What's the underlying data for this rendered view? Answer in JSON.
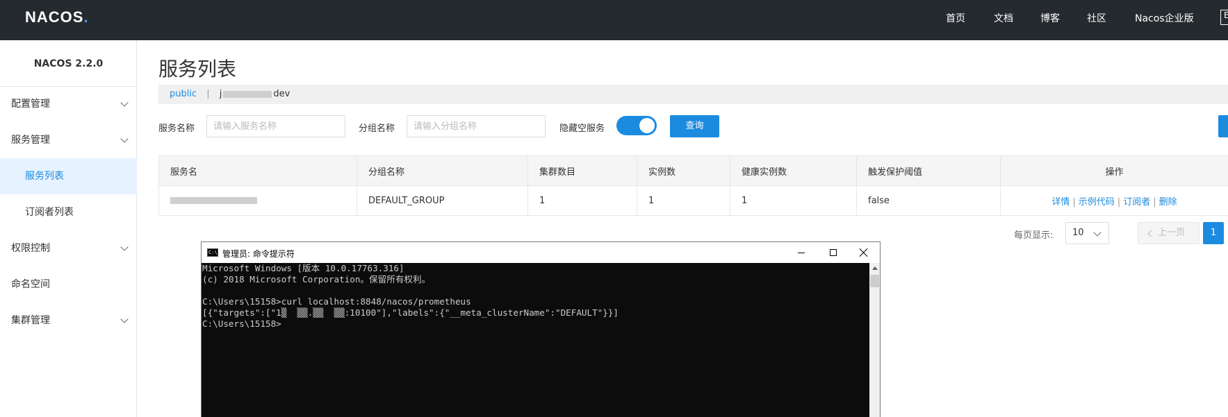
{
  "topnav": {
    "logo": "NACOS",
    "items": [
      "首页",
      "文档",
      "博客",
      "社区",
      "Nacos企业版"
    ],
    "lang": "E"
  },
  "sidebar": {
    "version": "NACOS 2.2.0",
    "items": [
      {
        "label": "配置管理",
        "expandable": true
      },
      {
        "label": "服务管理",
        "expandable": true
      },
      {
        "label": "服务列表",
        "active": true
      },
      {
        "label": "订阅者列表"
      },
      {
        "label": "权限控制",
        "expandable": true
      },
      {
        "label": "命名空间"
      },
      {
        "label": "集群管理",
        "expandable": true
      }
    ]
  },
  "main": {
    "title": "服务列表",
    "namespace": {
      "active": "public",
      "other_suffix": "dev"
    },
    "filters": {
      "service_name_label": "服务名称",
      "service_name_placeholder": "请输入服务名称",
      "group_name_label": "分组名称",
      "group_name_placeholder": "请输入分组名称",
      "hide_empty_label": "隐藏空服务",
      "hide_empty_on": true,
      "query_button": "查询"
    },
    "table": {
      "headers": [
        "服务名",
        "分组名称",
        "集群数目",
        "实例数",
        "健康实例数",
        "触发保护阈值",
        "操作"
      ],
      "rows": [
        {
          "service": "",
          "group": "DEFAULT_GROUP",
          "clusters": "1",
          "instances": "1",
          "healthy": "1",
          "protect": "false"
        }
      ],
      "ops": [
        "详情",
        "示例代码",
        "订阅者",
        "删除"
      ],
      "op_separator": "|"
    },
    "pagination": {
      "per_page_label": "每页显示:",
      "per_page_value": "10",
      "prev_label": "上一页",
      "current_page": "1"
    }
  },
  "cmd": {
    "title": "管理员: 命令提示符",
    "icon_text": "C:\\",
    "lines": [
      "Microsoft Windows [版本 10.0.17763.316]",
      "(c) 2018 Microsoft Corporation。保留所有权利。",
      "",
      "C:\\Users\\15158>curl localhost:8848/nacos/prometheus",
      "[{\"targets\":[\"1▒  ▒▒.▒▒  ▒▒:10100\"],\"labels\":{\"__meta_clusterName\":\"DEFAULT\"}}]",
      "C:\\Users\\15158>"
    ]
  },
  "colors": {
    "topbar": "#252a2f",
    "accent": "#1b8be0",
    "active_bg": "#e6f2ff",
    "console_bg": "#0c0c0c"
  }
}
